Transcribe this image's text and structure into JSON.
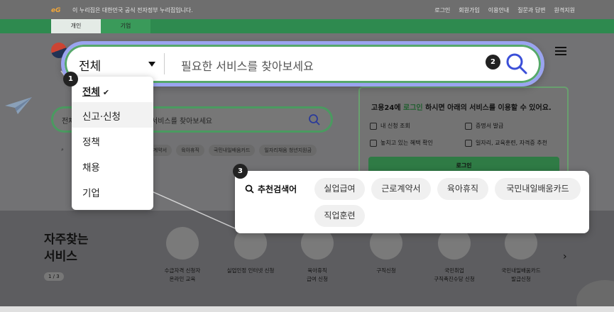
{
  "topbar": {
    "logo": "eG",
    "notice": "이 누리집은 대한민국 공식 전자정부 누리집입니다.",
    "links": [
      "로그인",
      "회원가입",
      "이용안내",
      "질문과 답변",
      "원격지원"
    ]
  },
  "audience_tabs": [
    "개인",
    "기업"
  ],
  "main_search": {
    "category": "전체",
    "placeholder": "필요한 서비스를 찾아보세요"
  },
  "bg_search": {
    "category": "전체",
    "placeholder": "서비스를 찾아보세요"
  },
  "bg_recommend": {
    "tags": [
      "근로계약서",
      "육아휴직",
      "국민내일배움카드",
      "일자리채움 청년지원금"
    ]
  },
  "category_dropdown": {
    "items": [
      "전체",
      "신고·신청",
      "정책",
      "채용",
      "기업"
    ],
    "selected": "전체"
  },
  "recommend": {
    "title": "추천검색어",
    "tags": [
      "실업급여",
      "근로계약서",
      "육아휴직",
      "국민내일배움카드",
      "직업훈련"
    ]
  },
  "login_box": {
    "title_pre": "고용24에 ",
    "title_link": "로그인",
    "title_post": " 하시면 아래의 서비스를 이용할 수 있어요.",
    "services": [
      "내 신청 조회",
      "증명서 발급",
      "놓치고 있는 혜택 확인",
      "일자리, 교육훈련, 자격증 추천"
    ],
    "login_button": "로그인"
  },
  "frequent": {
    "title_line1": "자주찾는",
    "title_line2": "서비스",
    "pager": "1 / 3",
    "items": [
      "수급자격 신청자\n온라인 교육",
      "실업인정 인터넷 신청",
      "육아휴직\n급여 신청",
      "구직신청",
      "국민취업\n구직촉진수당 신청",
      "국민내일배움카드\n발급신청"
    ]
  },
  "badges": [
    "1",
    "2",
    "3"
  ],
  "colors": {
    "accent_green": "#2e8a4f",
    "focus_ring": "#9aa4f0",
    "search_icon": "#3b4fd8"
  }
}
